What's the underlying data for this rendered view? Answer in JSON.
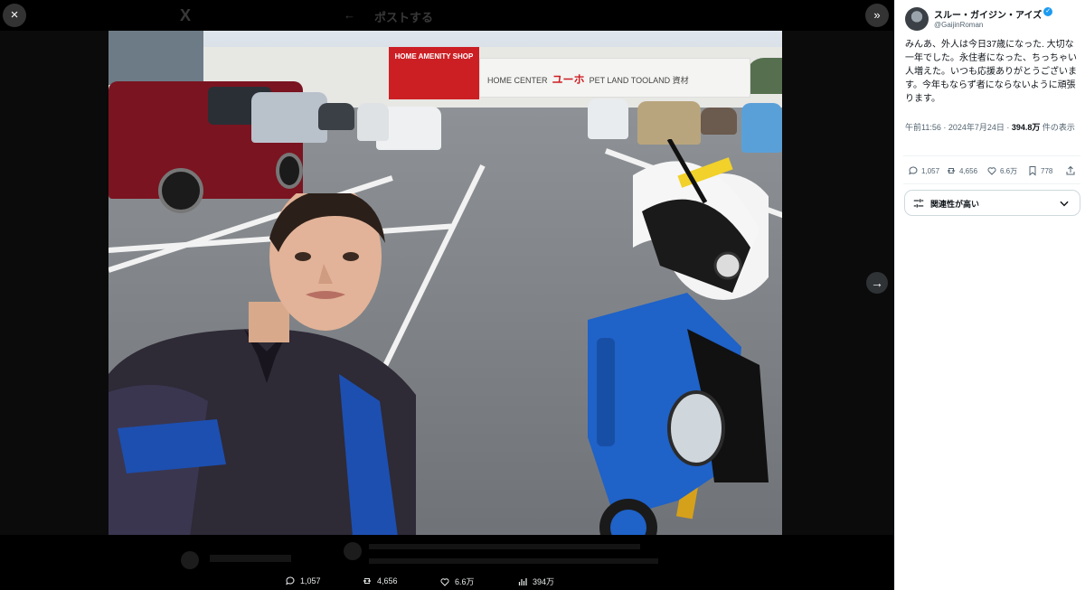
{
  "viewer": {
    "close_icon": "×",
    "logo": "X",
    "back_icon": "←",
    "header_title": "ポストする",
    "collapse_icon": "»",
    "next_icon": "→",
    "photo_signs": {
      "home_amenity": "HOME AMENITY SHOP",
      "home_center": "HOME CENTER",
      "pet_land": "PET LAND  TOOLAND 資材"
    }
  },
  "bottom_actions": {
    "replies": "1,057",
    "reposts": "4,656",
    "likes": "6.6万",
    "views": "394万"
  },
  "post": {
    "author_name": "スルー・ガイジン・アイズ",
    "handle": "@GaijinRoman",
    "text": "みんあ、外人は今日37歳になった. 大切な一年でした。永住者になった、ちっちゃい人増えた。いつも応援ありがとうございます。今年もならず者にならないように頑張ります。",
    "time": "午前11:56 · 2024年7月24日 · ",
    "views_count": "394.8万",
    "views_suffix": " 件の表示"
  },
  "stats": {
    "replies": "1,057",
    "reposts": "4,656",
    "likes": "6.6万",
    "bookmarks": "778"
  },
  "relevance": {
    "label": "関連性が高い"
  },
  "colors": {
    "accent": "#1d9bf0",
    "viewer_bg": "#0b0b0b"
  }
}
